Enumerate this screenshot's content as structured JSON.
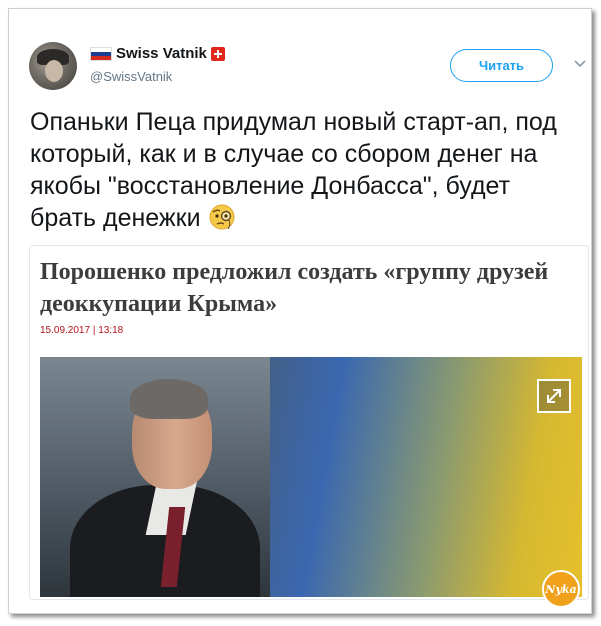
{
  "user": {
    "display_name": "Swiss Vatnik",
    "handle": "@SwissVatnik"
  },
  "follow_label": "Читать",
  "tweet": {
    "text": "Опаньки Пеца придумал новый старт-ап, под который, как и в случае со сбором денег на якобы \"восстановление Донбасса\", будет брать денежки",
    "emoji": "monocle-face-icon"
  },
  "card": {
    "title": "Порошенко предложил создать «группу друзей деоккупации Крыма»",
    "date": "15.09.2017 | 13:18"
  },
  "watermark": "Nyka",
  "colors": {
    "accent": "#1da1f2",
    "date": "#b0161c"
  }
}
